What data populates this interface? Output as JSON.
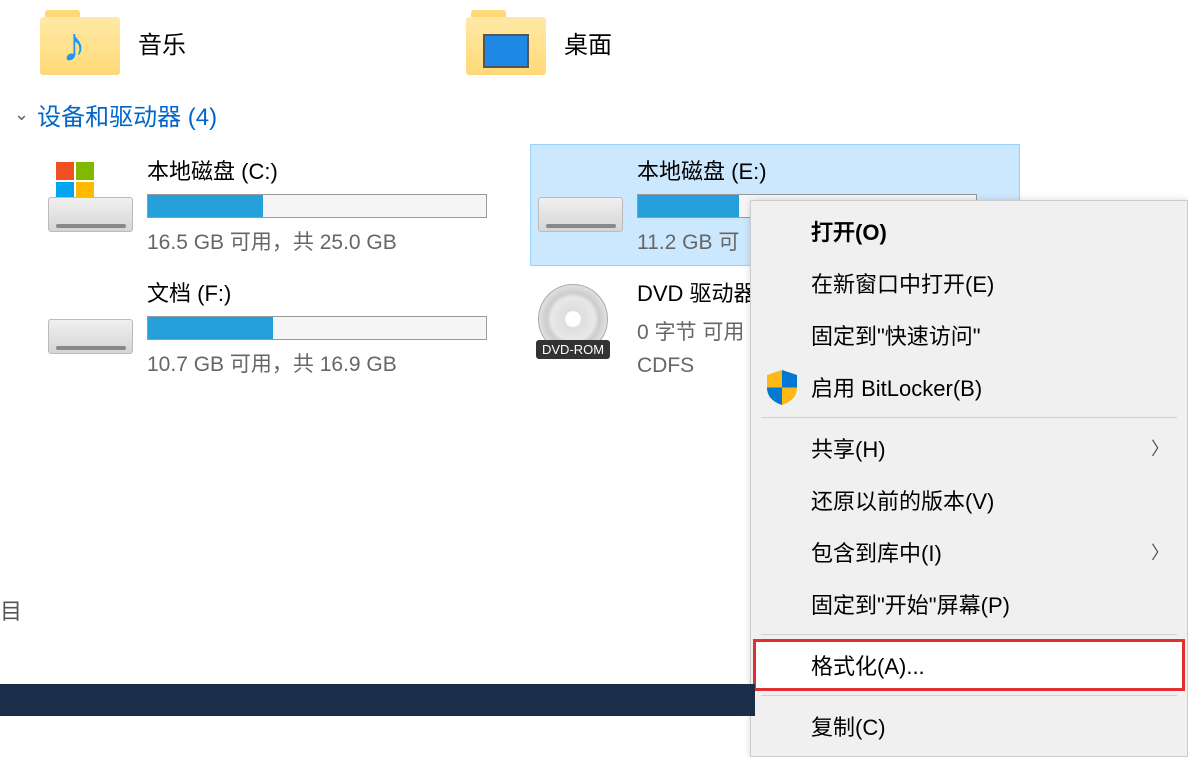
{
  "folders": {
    "music": {
      "label": "音乐"
    },
    "desktop": {
      "label": "桌面"
    }
  },
  "section": {
    "title": "设备和驱动器 (4)"
  },
  "drives": {
    "c": {
      "name": "本地磁盘 (C:)",
      "stats": "16.5 GB 可用，共 25.0 GB",
      "fill_percent": 34
    },
    "e": {
      "name": "本地磁盘 (E:)",
      "stats_partial": "11.2 GB 可",
      "fill_percent": 30
    },
    "f": {
      "name": "文档 (F:)",
      "stats": "10.7 GB 可用，共 16.9 GB",
      "fill_percent": 37
    },
    "dvd": {
      "name_partial": "DVD 驱动器",
      "line2_partial": "0 字节 可用",
      "fs": "CDFS",
      "badge": "DVD-ROM"
    }
  },
  "context_menu": {
    "open": "打开(O)",
    "open_new_window": "在新窗口中打开(E)",
    "pin_quick_access": "固定到\"快速访问\"",
    "bitlocker": "启用 BitLocker(B)",
    "share": "共享(H)",
    "restore_versions": "还原以前的版本(V)",
    "include_library": "包含到库中(I)",
    "pin_start": "固定到\"开始\"屏幕(P)",
    "format": "格式化(A)...",
    "copy": "复制(C)"
  },
  "side_char": "目"
}
